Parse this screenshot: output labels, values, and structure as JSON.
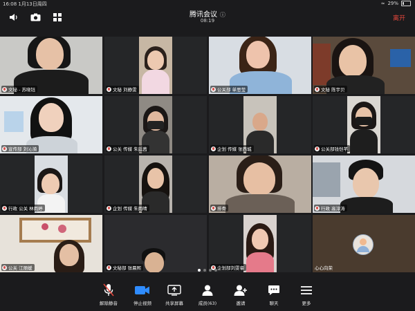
{
  "status": {
    "time_date": "16:08  1月13日周四",
    "battery": "29%"
  },
  "meeting": {
    "title": "腾讯会议",
    "info_icon": "info-icon",
    "timer": "08:19",
    "leave_label": "离开"
  },
  "participants": [
    {
      "name": "文秘 - 苏晓钰"
    },
    {
      "name": "文秘 刘静雯"
    },
    {
      "name": "公关部  单思莹"
    },
    {
      "name": "文秘  陈宇贝"
    },
    {
      "name": "宣传部  刘沁漪"
    },
    {
      "name": "公关  传媒  朱廷茜"
    },
    {
      "name": "企划  传媒  张西城"
    },
    {
      "name": "公关部钱恺芊"
    },
    {
      "name": "行政  公关  林雨婷"
    },
    {
      "name": "企划  传媒  朱雨晴"
    },
    {
      "name": "排骨"
    },
    {
      "name": "行政  高淳涛"
    },
    {
      "name": "公关  江丽媛"
    },
    {
      "name": "文秘部  张晨熙"
    },
    {
      "name": "企划部刘雯睿"
    },
    {
      "name": "心心向荣"
    }
  ],
  "page_indicator": {
    "pages": 4,
    "active": 0
  },
  "toolbar": [
    {
      "label": "解除静音",
      "icon": "mic-muted-icon"
    },
    {
      "label": "停止视频",
      "icon": "video-camera-icon"
    },
    {
      "label": "共享屏幕",
      "icon": "share-screen-icon"
    },
    {
      "label": "成员(63)",
      "icon": "members-icon"
    },
    {
      "label": "邀请",
      "icon": "invite-icon"
    },
    {
      "label": "聊天",
      "icon": "chat-icon"
    },
    {
      "label": "更多",
      "icon": "more-icon"
    }
  ],
  "colors": {
    "background": "#1b1b1d",
    "leave": "#e5473c",
    "video_active": "#2f8cff",
    "tile": "#252628"
  }
}
